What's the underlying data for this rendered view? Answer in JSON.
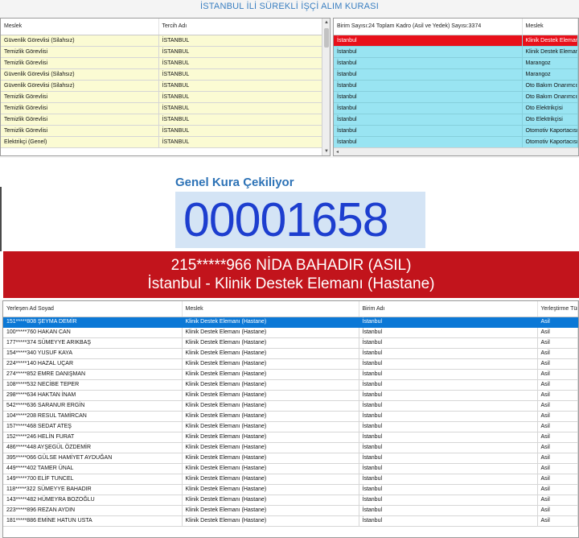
{
  "app": {
    "title": "İSTANBUL İLİ SÜREKLİ İŞÇİ ALIM KURASI"
  },
  "top_left_grid": {
    "columns": [
      "Meslek",
      "Tercih Adı"
    ],
    "rows": [
      [
        "Güvenlik Görevlisi (Silahsız)",
        "İSTANBUL"
      ],
      [
        "Temizlik Görevlisi",
        "İSTANBUL"
      ],
      [
        "Temizlik Görevlisi",
        "İSTANBUL"
      ],
      [
        "Güvenlik Görevlisi (Silahsız)",
        "İSTANBUL"
      ],
      [
        "Güvenlik Görevlisi (Silahsız)",
        "İSTANBUL"
      ],
      [
        "Temizlik Görevlisi",
        "İSTANBUL"
      ],
      [
        "Temizlik Görevlisi",
        "İSTANBUL"
      ],
      [
        "Temizlik Görevlisi",
        "İSTANBUL"
      ],
      [
        "Temizlik Görevlisi",
        "İSTANBUL"
      ],
      [
        "Elektrikçi (Genel)",
        "İSTANBUL"
      ]
    ]
  },
  "top_right_grid": {
    "columns": [
      "Birim Sayısı:24 Toplam Kadro (Asil ve Yedek) Sayısı:3374",
      "Meslek"
    ],
    "rows": [
      [
        "İstanbul",
        "Klinik Destek Elemanı (H"
      ],
      [
        "İstanbul",
        "Klinik Destek Elemanı (K"
      ],
      [
        "İstanbul",
        "Marangoz"
      ],
      [
        "İstanbul",
        "Marangoz"
      ],
      [
        "İstanbul",
        "Oto Bakım Onarımcısı (O"
      ],
      [
        "İstanbul",
        "Oto Bakım Onarımcısı (O"
      ],
      [
        "İstanbul",
        "Oto Elektrikçisi"
      ],
      [
        "İstanbul",
        "Oto Elektrikçisi"
      ],
      [
        "İstanbul",
        "Otomotiv Kaportacısı"
      ],
      [
        "İstanbul",
        "Otomotiv Kaportacısı"
      ]
    ],
    "selected_index": 0
  },
  "draw": {
    "label": "Genel Kura Çekiliyor",
    "counter": "00001658",
    "winner_line1": "215*****966 NİDA BAHADIR (ASIL)",
    "winner_line2": "İstanbul - Klinik Destek Elemanı (Hastane)"
  },
  "bottom_grid": {
    "columns": [
      "Yerleşen Ad Soyad",
      "Meslek",
      "Birim Adı",
      "Yerleştirme Türü"
    ],
    "selected_index": 0,
    "rows": [
      [
        "151*****808 ŞEYMA DEMİR",
        "Klinik Destek Elemanı (Hastane)",
        "İstanbul",
        "Asil"
      ],
      [
        "100*****760 HAKAN CAN",
        "Klinik Destek Elemanı (Hastane)",
        "İstanbul",
        "Asil"
      ],
      [
        "177*****374 SÜMEYYE ARIKBAŞ",
        "Klinik Destek Elemanı (Hastane)",
        "İstanbul",
        "Asil"
      ],
      [
        "154*****340 YUSUF KAYA",
        "Klinik Destek Elemanı (Hastane)",
        "İstanbul",
        "Asil"
      ],
      [
        "224*****140 HAZAL UÇAR",
        "Klinik Destek Elemanı (Hastane)",
        "İstanbul",
        "Asil"
      ],
      [
        "274*****852 EMRE DANIŞMAN",
        "Klinik Destek Elemanı (Hastane)",
        "İstanbul",
        "Asil"
      ],
      [
        "108*****532 NECİBE TEPER",
        "Klinik Destek Elemanı (Hastane)",
        "İstanbul",
        "Asil"
      ],
      [
        "298*****634 HAKTAN İNAM",
        "Klinik Destek Elemanı (Hastane)",
        "İstanbul",
        "Asil"
      ],
      [
        "542*****636 SARANUR ERGİN",
        "Klinik Destek Elemanı (Hastane)",
        "İstanbul",
        "Asil"
      ],
      [
        "104*****208 RESUL TAMİRCAN",
        "Klinik Destek Elemanı (Hastane)",
        "İstanbul",
        "Asil"
      ],
      [
        "157*****468 SEDAT ATEŞ",
        "Klinik Destek Elemanı (Hastane)",
        "İstanbul",
        "Asil"
      ],
      [
        "152*****246 HELİN FURAT",
        "Klinik Destek Elemanı (Hastane)",
        "İstanbul",
        "Asil"
      ],
      [
        "486*****448 AYŞEGÜL ÖZDEMİR",
        "Klinik Destek Elemanı (Hastane)",
        "İstanbul",
        "Asil"
      ],
      [
        "395*****066 GÜLSE HAMİYET AYDUĞAN",
        "Klinik Destek Elemanı (Hastane)",
        "İstanbul",
        "Asil"
      ],
      [
        "449*****402 TAMER ÜNAL",
        "Klinik Destek Elemanı (Hastane)",
        "İstanbul",
        "Asil"
      ],
      [
        "149*****700 ELİF TUNCEL",
        "Klinik Destek Elemanı (Hastane)",
        "İstanbul",
        "Asil"
      ],
      [
        "118*****322 SÜMEYYE BAHADIR",
        "Klinik Destek Elemanı (Hastane)",
        "İstanbul",
        "Asil"
      ],
      [
        "143*****482 HÜMEYRA BOZOĞLU",
        "Klinik Destek Elemanı (Hastane)",
        "İstanbul",
        "Asil"
      ],
      [
        "223*****896 REZAN AYDIN",
        "Klinik Destek Elemanı (Hastane)",
        "İstanbul",
        "Asil"
      ],
      [
        "181*****886 EMİNE HATUN USTA",
        "Klinik Destek Elemanı (Hastane)",
        "İstanbul",
        "Asil"
      ]
    ]
  }
}
